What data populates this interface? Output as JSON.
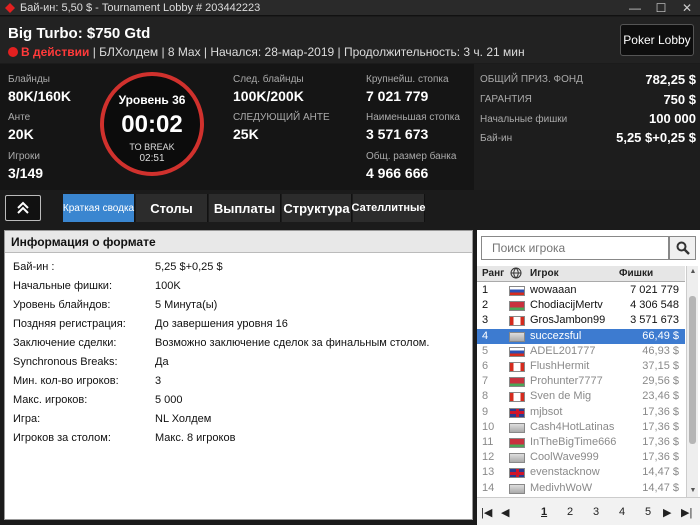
{
  "window": {
    "title": "Бай-ин: 5,50 $ - Tournament Lobby # 203442223",
    "min": "—",
    "max": "☐",
    "close": "✕"
  },
  "header": {
    "title": "Big Turbo: $750 Gtd",
    "status": "В действии",
    "info": "| БЛХолдем | 8 Max | Начался: 28-мар-2019 | Продолжительность: 3 ч. 21 мин",
    "lobby_button": "Poker Lobby"
  },
  "stats": {
    "blinds_label": "Блайнды",
    "blinds_value": "80K/160K",
    "ante_label": "Анте",
    "ante_value": "20K",
    "players_label": "Игроки",
    "players_value": "3/149",
    "next_blinds_label": "След. блайнды",
    "next_blinds_value": "100K/200K",
    "next_ante_label": "СЛЕДУЮЩИЙ АНТЕ",
    "next_ante_value": "25K",
    "largest_label": "Крупнейш. стопка",
    "largest_value": "7 021 779",
    "smallest_label": "Наименьшая стопка",
    "smallest_value": "3 571 673",
    "bank_label": "Общ. размер банка",
    "bank_value": "4 966 666"
  },
  "timer": {
    "level": "Уровень 36",
    "clock": "00:02",
    "break_label": "TO BREAK",
    "break_time": "02:51"
  },
  "prize": {
    "pool_label": "ОБЩИЙ ПРИЗ. ФОНД",
    "pool_value": "782,25 $",
    "guarantee_label": "ГАРАНТИЯ",
    "guarantee_value": "750 $",
    "chips_label": "Начальные фишки",
    "chips_value": "100 000",
    "buyin_label": "Бай-ин",
    "buyin_value": "5,25 $+0,25 $"
  },
  "tabs": [
    {
      "label": "Краткая сводка",
      "active": true
    },
    {
      "label": "Столы",
      "active": false
    },
    {
      "label": "Выплаты",
      "active": false
    },
    {
      "label": "Структура",
      "active": false
    },
    {
      "label": "Сателлитные",
      "active": false
    }
  ],
  "info": {
    "title": "Информация о формате",
    "rows": [
      {
        "k": "Бай-ин :",
        "v": "5,25 $+0,25 $"
      },
      {
        "k": "Начальные фишки:",
        "v": "100K"
      },
      {
        "k": "Уровень блайндов:",
        "v": "5 Минута(ы)"
      },
      {
        "k": "Поздняя регистрация:",
        "v": "До завершения уровня 16"
      },
      {
        "k": "Заключение сделки:",
        "v": "Возможно заключение сделок за финальным столом."
      },
      {
        "k": "Synchronous Breaks:",
        "v": "Да"
      },
      {
        "k": "Мин. кол-во игроков:",
        "v": "3"
      },
      {
        "k": "Макс. игроков:",
        "v": "5 000"
      },
      {
        "k": "Игра:",
        "v": "NL Холдем"
      },
      {
        "k": "Игроков за столом:",
        "v": "Макс. 8 игроков"
      }
    ]
  },
  "players": {
    "search_placeholder": "Поиск игрока",
    "col_rank": "Ранг",
    "col_name": "Игрок",
    "col_chips": "Фишки",
    "rows": [
      {
        "rank": "1",
        "name": "wowaaan",
        "chips": "7 021 779",
        "flag": "ru",
        "state": "normal"
      },
      {
        "rank": "2",
        "name": "ChodiacijMertv",
        "chips": "4 306 548",
        "flag": "by",
        "state": "normal"
      },
      {
        "rank": "3",
        "name": "GrosJambon99",
        "chips": "3 571 673",
        "flag": "ca",
        "state": "normal"
      },
      {
        "rank": "4",
        "name": "succezsful",
        "chips": "66,49 $",
        "flag": "xx",
        "state": "selected"
      },
      {
        "rank": "5",
        "name": "ADEL201777",
        "chips": "46,93 $",
        "flag": "ru",
        "state": "dim"
      },
      {
        "rank": "6",
        "name": "FlushHermit",
        "chips": "37,15 $",
        "flag": "ca",
        "state": "dim"
      },
      {
        "rank": "7",
        "name": "Prohunter7777",
        "chips": "29,56 $",
        "flag": "by",
        "state": "dim"
      },
      {
        "rank": "8",
        "name": "Sven de Mig",
        "chips": "23,46 $",
        "flag": "ca",
        "state": "dim"
      },
      {
        "rank": "9",
        "name": "mjbsot",
        "chips": "17,36 $",
        "flag": "uk",
        "state": "dim"
      },
      {
        "rank": "10",
        "name": "Cash4HotLatinas",
        "chips": "17,36 $",
        "flag": "xx",
        "state": "dim"
      },
      {
        "rank": "11",
        "name": "InTheBigTime666",
        "chips": "17,36 $",
        "flag": "by",
        "state": "dim"
      },
      {
        "rank": "12",
        "name": "CoolWave999",
        "chips": "17,36 $",
        "flag": "xx",
        "state": "dim"
      },
      {
        "rank": "13",
        "name": "evenstacknow",
        "chips": "14,47 $",
        "flag": "uk",
        "state": "dim"
      },
      {
        "rank": "14",
        "name": "MedivhWoW",
        "chips": "14,47 $",
        "flag": "xx",
        "state": "dim"
      }
    ]
  },
  "pager": {
    "first": "|◀",
    "prev": "◀",
    "pages": [
      "1",
      "2",
      "3",
      "4",
      "5"
    ],
    "current": "1",
    "next": "▶",
    "last": "▶|"
  },
  "colors": {
    "accent": "#3a86d0",
    "timer_ring": "#d0312d",
    "status": "#ff3a3a",
    "selected_row": "#3d7bd0"
  }
}
